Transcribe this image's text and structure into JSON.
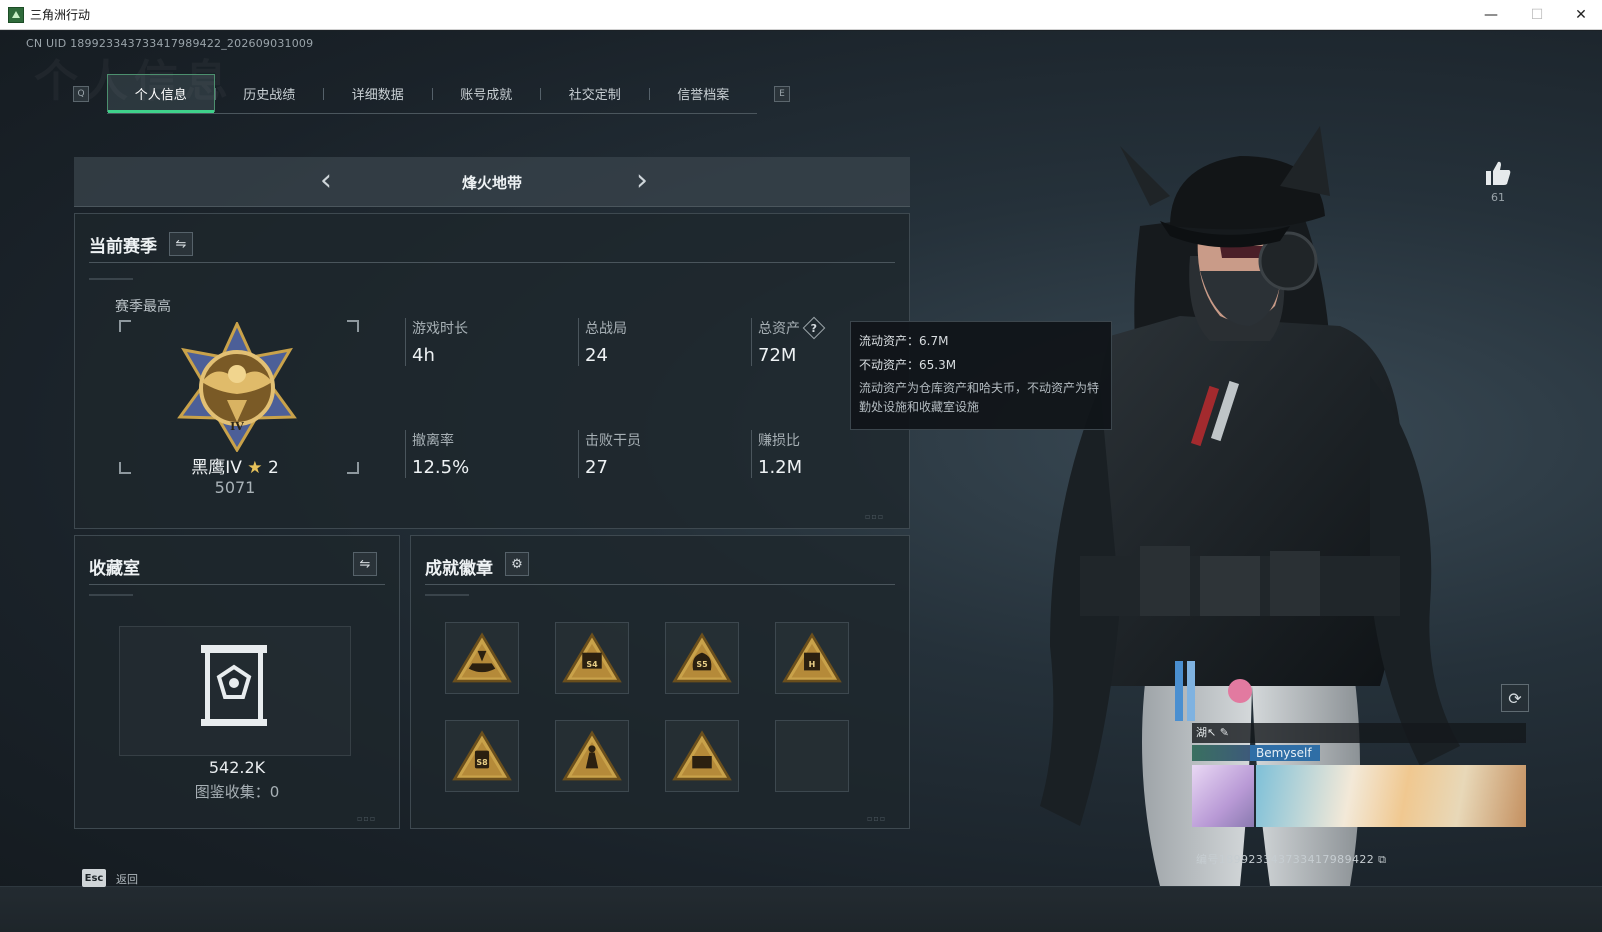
{
  "window": {
    "title": "三角洲行动",
    "min": "—",
    "max": "☐",
    "close": "✕"
  },
  "uid_line": "CN UID 18992334373341798942​2_202609031009",
  "tabs": {
    "prev_key": "Q",
    "next_key": "E",
    "items": [
      "个人信息",
      "历史战绩",
      "详细数据",
      "账号成就",
      "社交定制",
      "信誉档案"
    ],
    "active_index": 0
  },
  "mode": {
    "title": "烽火地带",
    "prev": "‹",
    "next": "›"
  },
  "season": {
    "title": "当前赛季",
    "swap_icon": "⇋",
    "high_label": "赛季最高",
    "rank_name": "黑鹰IV",
    "rank_stars": "2",
    "score": "5071",
    "stats": [
      {
        "label": "游戏时长",
        "value": "4h"
      },
      {
        "label": "总战局",
        "value": "24"
      },
      {
        "label": "总资产",
        "value": "72M"
      },
      {
        "label": "撤离率",
        "value": "12.5%"
      },
      {
        "label": "击败干员",
        "value": "27"
      },
      {
        "label": "赚损比",
        "value": "1.2M"
      }
    ],
    "help_icon": "?"
  },
  "tooltip": {
    "liquid": "流动资产：6.7M",
    "fixed": "不动资产：65.3M",
    "desc": "流动资产为仓库资产和哈夫币，不动资产为特勤处设施和收藏室设施"
  },
  "vault": {
    "title": "收藏室",
    "value": "542.2K",
    "collect": "图鉴收集：0"
  },
  "badges": {
    "title": "成就徽章",
    "settings_icon": "⚙",
    "slots": [
      {
        "icon": "boat-badge-icon",
        "label": ""
      },
      {
        "icon": "s4-badge-icon",
        "label": "S4"
      },
      {
        "icon": "s5-bag-badge-icon",
        "label": "S5"
      },
      {
        "icon": "h-badge-icon",
        "label": "H"
      },
      {
        "icon": "s8-badge-icon",
        "label": "S8"
      },
      {
        "icon": "soldier-badge-icon",
        "label": ""
      },
      {
        "icon": "crate-badge-icon",
        "label": ""
      },
      {
        "icon": "empty-slot",
        "label": ""
      }
    ]
  },
  "likes": {
    "count": "61"
  },
  "profile_card": {
    "top_text": "湖↖ ✎",
    "name": "Bemyself",
    "id_line": "编号18992334373341798942​2"
  },
  "bottom": {
    "esc_key": "Esc",
    "esc_label": "返回"
  },
  "colors": {
    "accent": "#3fd18b",
    "gold": "#c9a24a",
    "panel_border": "#3e4950"
  }
}
